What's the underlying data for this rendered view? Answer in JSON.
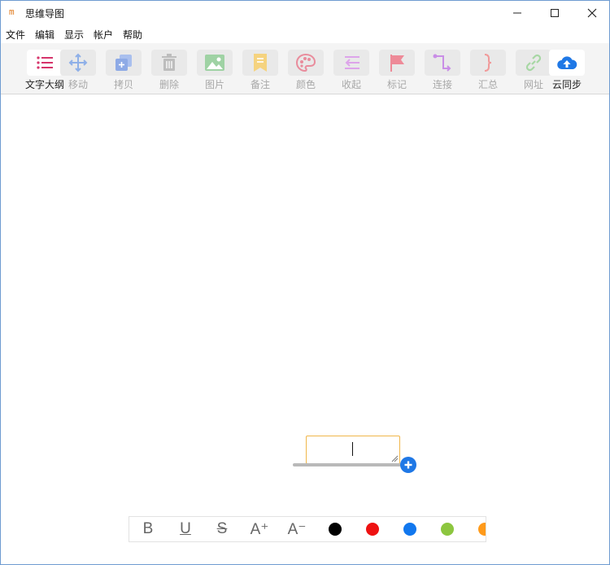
{
  "window": {
    "title": "思维导图",
    "app_icon_glyph": "m"
  },
  "menu": [
    "文件",
    "编辑",
    "显示",
    "帐户",
    "帮助"
  ],
  "toolbar": [
    {
      "label": "文字大纲",
      "icon": "outline-list-icon",
      "enabled": true,
      "active": true
    },
    {
      "label": "移动",
      "icon": "move-arrows-icon",
      "enabled": false
    },
    {
      "label": "拷贝",
      "icon": "copy-icon",
      "enabled": false
    },
    {
      "label": "删除",
      "icon": "trash-icon",
      "enabled": false
    },
    {
      "label": "图片",
      "icon": "image-icon",
      "enabled": false
    },
    {
      "label": "备注",
      "icon": "note-icon",
      "enabled": false
    },
    {
      "label": "颜色",
      "icon": "palette-icon",
      "enabled": false
    },
    {
      "label": "收起",
      "icon": "collapse-icon",
      "enabled": false
    },
    {
      "label": "标记",
      "icon": "flag-icon",
      "enabled": false
    },
    {
      "label": "连接",
      "icon": "connect-icon",
      "enabled": false
    },
    {
      "label": "汇总",
      "icon": "brace-icon",
      "enabled": false
    },
    {
      "label": "网址",
      "icon": "link-icon",
      "enabled": false
    },
    {
      "label": "云同步",
      "icon": "cloud-upload-icon",
      "enabled": true
    }
  ],
  "format_bar": {
    "bold": "B",
    "underline": "U",
    "strike": "S",
    "font_up": "A⁺",
    "font_down": "A⁻",
    "colors": [
      "#000000",
      "#ee1111",
      "#1177ee",
      "#8cc63f",
      "#ff9a1a"
    ]
  }
}
